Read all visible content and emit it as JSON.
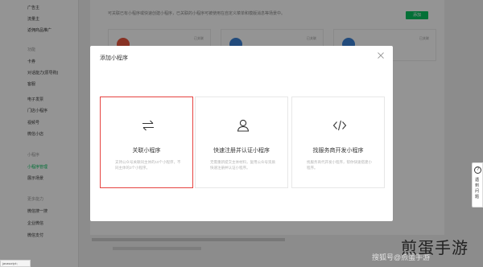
{
  "sidebar": {
    "items": [
      {
        "label": "广告主",
        "kind": "item"
      },
      {
        "label": "流量主",
        "kind": "item"
      },
      {
        "label": "返佣商品推广",
        "kind": "item"
      },
      {
        "label": "功能",
        "kind": "group"
      },
      {
        "label": "卡券",
        "kind": "item"
      },
      {
        "label": "对话能力(原导购)",
        "kind": "item"
      },
      {
        "label": "客服",
        "kind": "item"
      },
      {
        "label": "电子发票",
        "kind": "item"
      },
      {
        "label": "门店小程序",
        "kind": "item"
      },
      {
        "label": "视频号",
        "kind": "item"
      },
      {
        "label": "微信小店",
        "kind": "item"
      },
      {
        "label": "小程序",
        "kind": "group"
      },
      {
        "label": "小程序管理",
        "kind": "active"
      },
      {
        "label": "展示场景",
        "kind": "item"
      },
      {
        "label": "更多能力",
        "kind": "group"
      },
      {
        "label": "微信搜一搜",
        "kind": "item"
      },
      {
        "label": "企业微信",
        "kind": "item"
      },
      {
        "label": "微信支付",
        "kind": "item"
      }
    ]
  },
  "background": {
    "description": "可关联已有小程序或快速创建小程序，已关联的小程序可被使用在自定义菜单和模版消息等场景中。",
    "add_button": "添加",
    "card_tag": "已关联"
  },
  "modal": {
    "title": "添加小程序",
    "options": [
      {
        "title": "关联小程序",
        "desc": "支持公众号关联同主体的10个小程序，不同主体的3个小程序。",
        "icon": "swap-arrows-icon",
        "selected": true
      },
      {
        "title": "快速注册并认证小程序",
        "desc": "无需重新提交主体材料，复用公众号资质快速注册并认证小程序。",
        "icon": "user-icon",
        "selected": false
      },
      {
        "title": "找服务商开发小程序",
        "desc": "找服务商代开发小程序，帮你快速搭建小程序。",
        "icon": "code-icon",
        "selected": false
      }
    ]
  },
  "float_help": {
    "q": "?",
    "label": "遇到问题"
  },
  "watermark": {
    "main": "煎蛋手游",
    "sub": "搜狐号@煎蛋手游"
  },
  "url_tooltip": "javascript:;",
  "colors": {
    "accent_green": "#07c160",
    "selected_border": "#e64340"
  }
}
